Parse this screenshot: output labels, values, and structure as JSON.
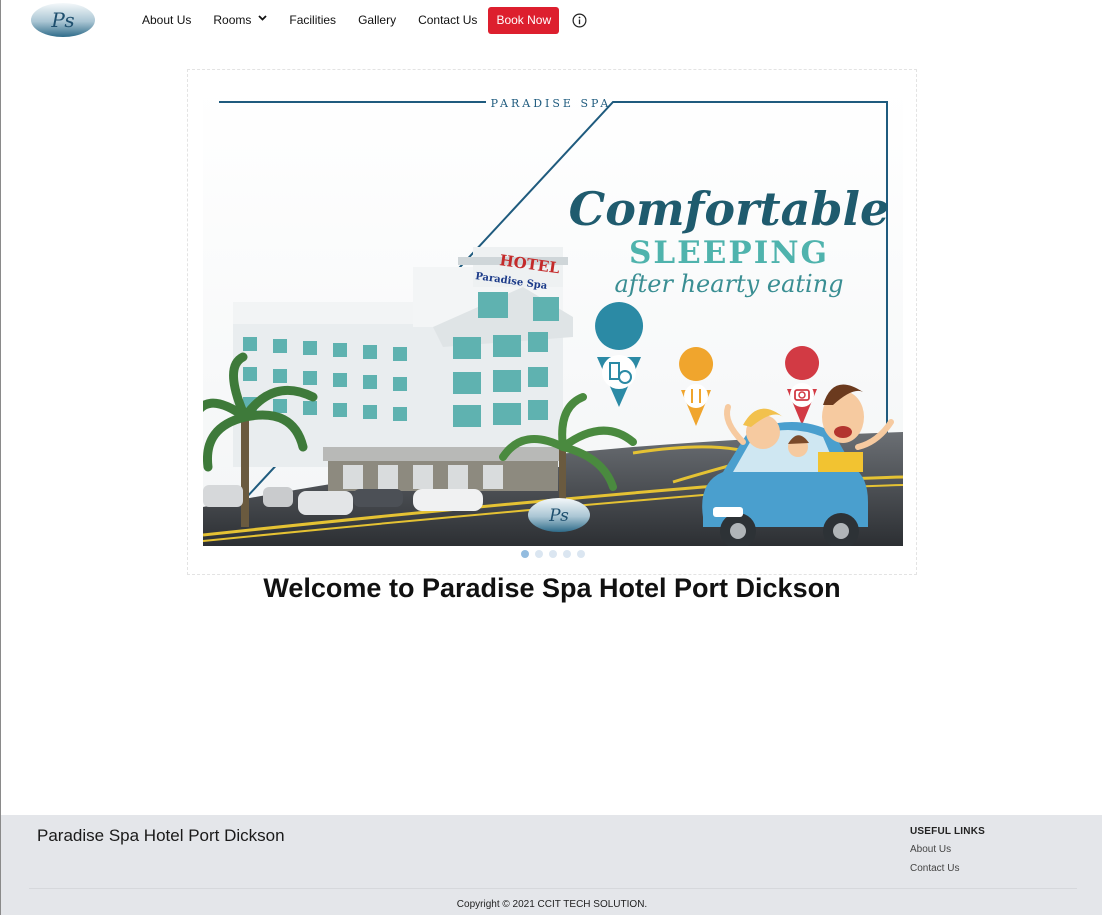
{
  "brand": {
    "logo_icon": "ps-monogram-logo",
    "logo_text": "Ps"
  },
  "nav": {
    "items": [
      {
        "label": "About Us"
      },
      {
        "label": "Rooms",
        "icon": "chevron-down-icon"
      },
      {
        "label": "Facilities"
      },
      {
        "label": "Gallery"
      },
      {
        "label": "Contact Us"
      }
    ],
    "book_label": "Book Now",
    "info_icon": "info-icon",
    "accent_color": "#dd1f2e"
  },
  "banner": {
    "frame_title": "PARADISE SPA",
    "headline_1": "Comfortable",
    "headline_2": "SLEEPING",
    "headline_3": "after hearty eating",
    "hotel_sign_1": "HOTEL",
    "hotel_sign_2": "Paradise Spa",
    "slide_count": 5,
    "active_slide": 1
  },
  "main": {
    "welcome": "Welcome to Paradise Spa Hotel Port Dickson"
  },
  "footer": {
    "title": "Paradise Spa Hotel Port Dickson",
    "useful_links_heading": "USEFUL LINKS",
    "links": [
      {
        "label": "About Us"
      },
      {
        "label": "Contact Us"
      }
    ],
    "copyright": "Copyright © 2021 CCIT TECH SOLUTION."
  }
}
